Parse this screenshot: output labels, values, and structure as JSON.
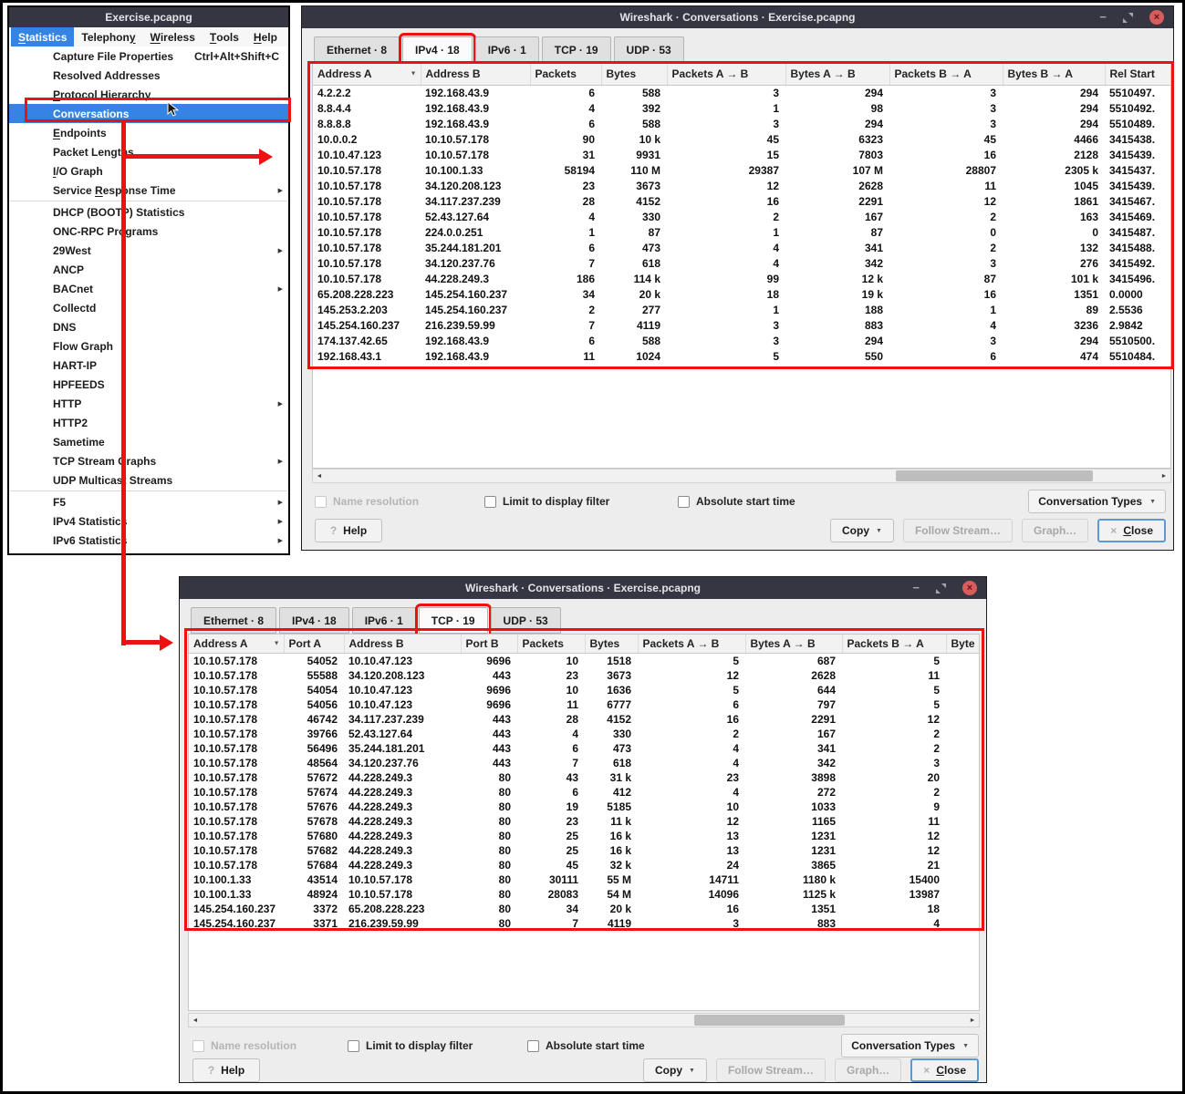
{
  "colors": {
    "annotation_red": "#ee1111",
    "menu_highlight_blue": "#3584e4",
    "titlebar": "#363642",
    "close_button_red": "#d85c5c"
  },
  "icons": {
    "submenu_arrow": "▶",
    "sort_indicator": "▼",
    "dropdown_arrow": "▼",
    "scroll_left": "◄",
    "scroll_right": "►",
    "minimize": "−",
    "close_glyph": "×",
    "help_glyph": "?"
  },
  "left_window": {
    "title": "Exercise.pcapng",
    "menubar": [
      {
        "label": "Statistics",
        "u": 0,
        "active": true
      },
      {
        "label": "Telephony",
        "u": 8
      },
      {
        "label": "Wireless",
        "u": 0
      },
      {
        "label": "Tools",
        "u": 0
      },
      {
        "label": "Help",
        "u": 0
      }
    ],
    "menu": [
      {
        "label": "Capture File Properties",
        "shortcut": "Ctrl+Alt+Shift+C"
      },
      {
        "label": "Resolved Addresses"
      },
      {
        "label": "Protocol Hierarchy",
        "u": 0
      },
      {
        "label": "Conversations",
        "u": 0,
        "selected": true
      },
      {
        "label": "Endpoints",
        "u": 0
      },
      {
        "label": "Packet Lengths"
      },
      {
        "label": "I/O Graph",
        "u": 0
      },
      {
        "label": "Service Response Time",
        "u": 8,
        "submenu": true,
        "separator_after": true
      },
      {
        "label": "DHCP (BOOTP) Statistics"
      },
      {
        "label": "ONC-RPC Programs"
      },
      {
        "label": "29West",
        "submenu": true
      },
      {
        "label": "ANCP"
      },
      {
        "label": "BACnet",
        "submenu": true
      },
      {
        "label": "Collectd"
      },
      {
        "label": "DNS"
      },
      {
        "label": "Flow Graph"
      },
      {
        "label": "HART-IP"
      },
      {
        "label": "HPFEEDS"
      },
      {
        "label": "HTTP",
        "submenu": true
      },
      {
        "label": "HTTP2"
      },
      {
        "label": "Sametime"
      },
      {
        "label": "TCP Stream Graphs",
        "submenu": true
      },
      {
        "label": "UDP Multicast Streams",
        "separator_after": true
      },
      {
        "label": "F5",
        "submenu": true
      },
      {
        "label": "IPv4 Statistics",
        "submenu": true
      },
      {
        "label": "IPv6 Statistics",
        "submenu": true
      }
    ]
  },
  "conversations_ipv4_window": {
    "title": "Wireshark · Conversations · Exercise.pcapng",
    "tabs": [
      "Ethernet · 8",
      "IPv4 · 18",
      "IPv6 · 1",
      "TCP · 19",
      "UDP · 53"
    ],
    "active_tab": "IPv4 · 18",
    "table": {
      "headers": [
        "Address A",
        "Address B",
        "Packets",
        "Bytes",
        "Packets A → B",
        "Bytes A → B",
        "Packets B → A",
        "Bytes B → A",
        "Rel Start"
      ],
      "rows": [
        [
          "4.2.2.2",
          "192.168.43.9",
          "6",
          "588",
          "3",
          "294",
          "3",
          "294",
          "5510497."
        ],
        [
          "8.8.4.4",
          "192.168.43.9",
          "4",
          "392",
          "1",
          "98",
          "3",
          "294",
          "5510492."
        ],
        [
          "8.8.8.8",
          "192.168.43.9",
          "6",
          "588",
          "3",
          "294",
          "3",
          "294",
          "5510489."
        ],
        [
          "10.0.0.2",
          "10.10.57.178",
          "90",
          "10 k",
          "45",
          "6323",
          "45",
          "4466",
          "3415438."
        ],
        [
          "10.10.47.123",
          "10.10.57.178",
          "31",
          "9931",
          "15",
          "7803",
          "16",
          "2128",
          "3415439."
        ],
        [
          "10.10.57.178",
          "10.100.1.33",
          "58194",
          "110 M",
          "29387",
          "107 M",
          "28807",
          "2305 k",
          "3415437."
        ],
        [
          "10.10.57.178",
          "34.120.208.123",
          "23",
          "3673",
          "12",
          "2628",
          "11",
          "1045",
          "3415439."
        ],
        [
          "10.10.57.178",
          "34.117.237.239",
          "28",
          "4152",
          "16",
          "2291",
          "12",
          "1861",
          "3415467."
        ],
        [
          "10.10.57.178",
          "52.43.127.64",
          "4",
          "330",
          "2",
          "167",
          "2",
          "163",
          "3415469."
        ],
        [
          "10.10.57.178",
          "224.0.0.251",
          "1",
          "87",
          "1",
          "87",
          "0",
          "0",
          "3415487."
        ],
        [
          "10.10.57.178",
          "35.244.181.201",
          "6",
          "473",
          "4",
          "341",
          "2",
          "132",
          "3415488."
        ],
        [
          "10.10.57.178",
          "34.120.237.76",
          "7",
          "618",
          "4",
          "342",
          "3",
          "276",
          "3415492."
        ],
        [
          "10.10.57.178",
          "44.228.249.3",
          "186",
          "114 k",
          "99",
          "12 k",
          "87",
          "101 k",
          "3415496."
        ],
        [
          "65.208.228.223",
          "145.254.160.237",
          "34",
          "20 k",
          "18",
          "19 k",
          "16",
          "1351",
          "0.0000"
        ],
        [
          "145.253.2.203",
          "145.254.160.237",
          "2",
          "277",
          "1",
          "188",
          "1",
          "89",
          "2.5536"
        ],
        [
          "145.254.160.237",
          "216.239.59.99",
          "7",
          "4119",
          "3",
          "883",
          "4",
          "3236",
          "2.9842"
        ],
        [
          "174.137.42.65",
          "192.168.43.9",
          "6",
          "588",
          "3",
          "294",
          "3",
          "294",
          "5510500."
        ],
        [
          "192.168.43.1",
          "192.168.43.9",
          "11",
          "1024",
          "5",
          "550",
          "6",
          "474",
          "5510484."
        ]
      ]
    }
  },
  "conversations_tcp_window": {
    "title": "Wireshark · Conversations · Exercise.pcapng",
    "tabs": [
      "Ethernet · 8",
      "IPv4 · 18",
      "IPv6 · 1",
      "TCP · 19",
      "UDP · 53"
    ],
    "active_tab": "TCP · 19",
    "table": {
      "headers": [
        "Address A",
        "Port A",
        "Address B",
        "Port B",
        "Packets",
        "Bytes",
        "Packets A → B",
        "Bytes A → B",
        "Packets B → A",
        "Byte"
      ],
      "rows": [
        [
          "10.10.57.178",
          "54052",
          "10.10.47.123",
          "9696",
          "10",
          "1518",
          "5",
          "687",
          "5",
          ""
        ],
        [
          "10.10.57.178",
          "55588",
          "34.120.208.123",
          "443",
          "23",
          "3673",
          "12",
          "2628",
          "11",
          ""
        ],
        [
          "10.10.57.178",
          "54054",
          "10.10.47.123",
          "9696",
          "10",
          "1636",
          "5",
          "644",
          "5",
          ""
        ],
        [
          "10.10.57.178",
          "54056",
          "10.10.47.123",
          "9696",
          "11",
          "6777",
          "6",
          "797",
          "5",
          ""
        ],
        [
          "10.10.57.178",
          "46742",
          "34.117.237.239",
          "443",
          "28",
          "4152",
          "16",
          "2291",
          "12",
          ""
        ],
        [
          "10.10.57.178",
          "39766",
          "52.43.127.64",
          "443",
          "4",
          "330",
          "2",
          "167",
          "2",
          ""
        ],
        [
          "10.10.57.178",
          "56496",
          "35.244.181.201",
          "443",
          "6",
          "473",
          "4",
          "341",
          "2",
          ""
        ],
        [
          "10.10.57.178",
          "48564",
          "34.120.237.76",
          "443",
          "7",
          "618",
          "4",
          "342",
          "3",
          ""
        ],
        [
          "10.10.57.178",
          "57672",
          "44.228.249.3",
          "80",
          "43",
          "31 k",
          "23",
          "3898",
          "20",
          ""
        ],
        [
          "10.10.57.178",
          "57674",
          "44.228.249.3",
          "80",
          "6",
          "412",
          "4",
          "272",
          "2",
          ""
        ],
        [
          "10.10.57.178",
          "57676",
          "44.228.249.3",
          "80",
          "19",
          "5185",
          "10",
          "1033",
          "9",
          ""
        ],
        [
          "10.10.57.178",
          "57678",
          "44.228.249.3",
          "80",
          "23",
          "11 k",
          "12",
          "1165",
          "11",
          ""
        ],
        [
          "10.10.57.178",
          "57680",
          "44.228.249.3",
          "80",
          "25",
          "16 k",
          "13",
          "1231",
          "12",
          ""
        ],
        [
          "10.10.57.178",
          "57682",
          "44.228.249.3",
          "80",
          "25",
          "16 k",
          "13",
          "1231",
          "12",
          ""
        ],
        [
          "10.10.57.178",
          "57684",
          "44.228.249.3",
          "80",
          "45",
          "32 k",
          "24",
          "3865",
          "21",
          ""
        ],
        [
          "10.100.1.33",
          "43514",
          "10.10.57.178",
          "80",
          "30111",
          "55 M",
          "14711",
          "1180 k",
          "15400",
          ""
        ],
        [
          "10.100.1.33",
          "48924",
          "10.10.57.178",
          "80",
          "28083",
          "54 M",
          "14096",
          "1125 k",
          "13987",
          ""
        ],
        [
          "145.254.160.237",
          "3372",
          "65.208.228.223",
          "80",
          "34",
          "20 k",
          "16",
          "1351",
          "18",
          ""
        ],
        [
          "145.254.160.237",
          "3371",
          "216.239.59.99",
          "80",
          "7",
          "4119",
          "3",
          "883",
          "4",
          ""
        ]
      ]
    }
  },
  "footer": {
    "name_resolution": "Name resolution",
    "limit_to_display_filter": "Limit to display filter",
    "absolute_start_time": "Absolute start time",
    "conversation_types": "Conversation Types",
    "help": "Help",
    "copy": "Copy",
    "follow_stream": "Follow Stream…",
    "graph": "Graph…",
    "close": "Close"
  }
}
